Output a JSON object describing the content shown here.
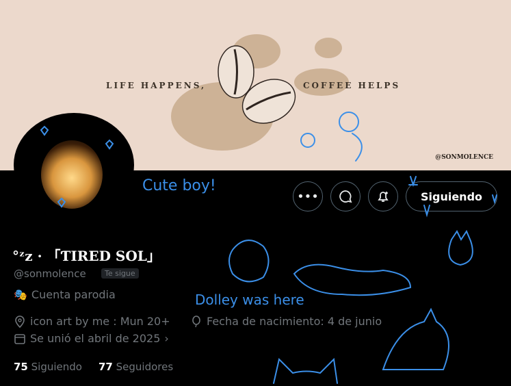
{
  "banner": {
    "text_left": "LIFE HAPPENS,",
    "text_right": "COFFEE HELPS",
    "credit": "@SONMOLENCE"
  },
  "doodles": {
    "cute_label": "Cute boy!",
    "dolley_label": "Dolley was here"
  },
  "actions": {
    "more_icon": "more-icon",
    "message_icon": "message-icon",
    "notify_icon": "notify-bell-icon",
    "follow_label": "Siguiendo"
  },
  "profile": {
    "display_name": "°ᶻz · 「ƬIRED SOL」",
    "handle": "@sonmolence",
    "follows_you": "Te sigue",
    "parody": "Cuenta parodia",
    "location": "icon art by me : Mun 20+",
    "birthday": "Fecha de nacimiento: 4 de junio",
    "joined": "Se unió el abril de 2025"
  },
  "stats": {
    "following_count": "75",
    "following_label": "Siguiendo",
    "followers_count": "77",
    "followers_label": "Seguidores"
  },
  "colors": {
    "doodle_blue": "#3b8fe8",
    "background": "#000000",
    "banner_bg": "#ecd9cc"
  }
}
